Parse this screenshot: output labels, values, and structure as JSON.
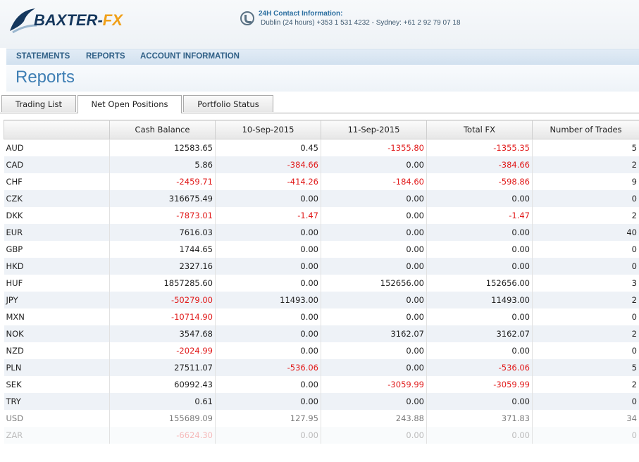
{
  "logo": {
    "main": "BAXTER-",
    "accent": "FX"
  },
  "contact": {
    "title": "24H Contact Information:",
    "detail": "Dublin (24 hours) +353 1 531 4232 - Sydney: +61 2 92 79 07 18"
  },
  "nav": [
    "STATEMENTS",
    "REPORTS",
    "ACCOUNT INFORMATION"
  ],
  "page_title": "Reports",
  "tabs": [
    {
      "label": "Trading List",
      "active": false
    },
    {
      "label": "Net Open Positions",
      "active": true
    },
    {
      "label": "Portfolio Status",
      "active": false
    }
  ],
  "table": {
    "headers": [
      "",
      "Cash Balance",
      "10-Sep-2015",
      "11-Sep-2015",
      "Total FX",
      "Number of Trades"
    ],
    "rows": [
      [
        "AUD",
        "12583.65",
        "0.45",
        "-1355.80",
        "-1355.35",
        "5"
      ],
      [
        "CAD",
        "5.86",
        "-384.66",
        "0.00",
        "-384.66",
        "2"
      ],
      [
        "CHF",
        "-2459.71",
        "-414.26",
        "-184.60",
        "-598.86",
        "9"
      ],
      [
        "CZK",
        "316675.49",
        "0.00",
        "0.00",
        "0.00",
        "0"
      ],
      [
        "DKK",
        "-7873.01",
        "-1.47",
        "0.00",
        "-1.47",
        "2"
      ],
      [
        "EUR",
        "7616.03",
        "0.00",
        "0.00",
        "0.00",
        "40"
      ],
      [
        "GBP",
        "1744.65",
        "0.00",
        "0.00",
        "0.00",
        "0"
      ],
      [
        "HKD",
        "2327.16",
        "0.00",
        "0.00",
        "0.00",
        "0"
      ],
      [
        "HUF",
        "1857285.60",
        "0.00",
        "152656.00",
        "152656.00",
        "3"
      ],
      [
        "JPY",
        "-50279.00",
        "11493.00",
        "0.00",
        "11493.00",
        "2"
      ],
      [
        "MXN",
        "-10714.90",
        "0.00",
        "0.00",
        "0.00",
        "0"
      ],
      [
        "NOK",
        "3547.68",
        "0.00",
        "3162.07",
        "3162.07",
        "2"
      ],
      [
        "NZD",
        "-2024.99",
        "0.00",
        "0.00",
        "0.00",
        "0"
      ],
      [
        "PLN",
        "27511.07",
        "-536.06",
        "0.00",
        "-536.06",
        "5"
      ],
      [
        "SEK",
        "60992.43",
        "0.00",
        "-3059.99",
        "-3059.99",
        "2"
      ],
      [
        "TRY",
        "0.61",
        "0.00",
        "0.00",
        "0.00",
        "0"
      ],
      [
        "USD",
        "155689.09",
        "127.95",
        "243.88",
        "371.83",
        "34"
      ],
      [
        "ZAR",
        "-6624.30",
        "0.00",
        "0.00",
        "0.00",
        "0"
      ]
    ]
  },
  "colors": {
    "negative": "#e11a1a",
    "title": "#3f7fb4",
    "nav": "#2f5f86"
  }
}
